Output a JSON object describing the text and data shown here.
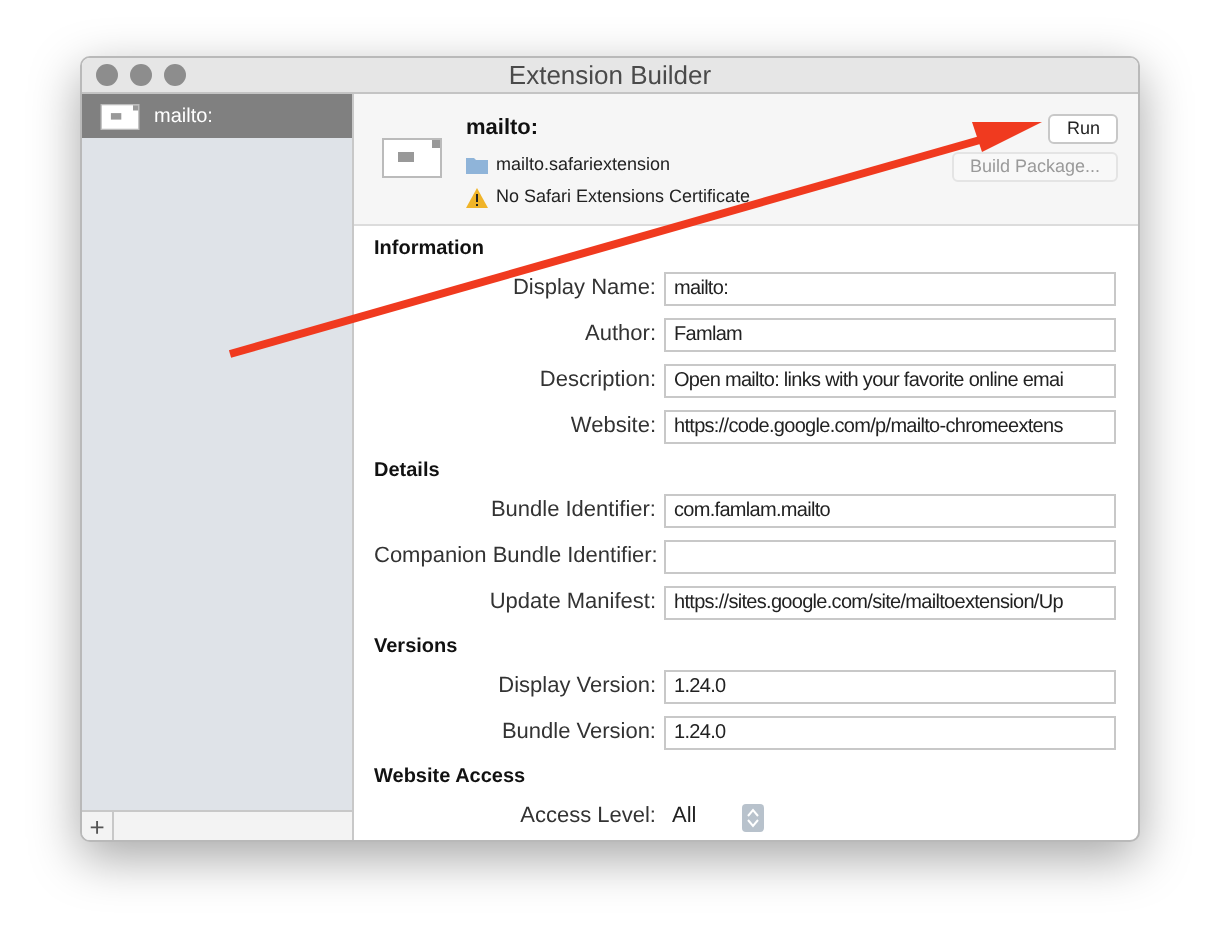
{
  "window": {
    "title": "Extension Builder"
  },
  "sidebar": {
    "items": [
      {
        "label": "mailto:",
        "selected": true
      }
    ],
    "add_button": "+"
  },
  "header": {
    "name": "mailto:",
    "file": "mailto.safariextension",
    "warning": "No Safari Extensions Certificate",
    "buttons": [
      {
        "label": "Run",
        "disabled": false
      },
      {
        "label": "Build Package...",
        "disabled": true
      }
    ]
  },
  "sections": [
    {
      "title": "Information",
      "fields": [
        {
          "label": "Display Name:",
          "value": "mailto:"
        },
        {
          "label": "Author:",
          "value": "Famlam"
        },
        {
          "label": "Description:",
          "value": "Open mailto: links with your favorite online emai"
        },
        {
          "label": "Website:",
          "value": "https://code.google.com/p/mailto-chromeextens"
        }
      ]
    },
    {
      "title": "Details",
      "fields": [
        {
          "label": "Bundle Identifier:",
          "value": "com.famlam.mailto"
        },
        {
          "label": "Companion Bundle Identifier:"
        },
        {
          "label": "Update Manifest:",
          "value": "https://sites.google.com/site/mailtoextension/Up"
        }
      ]
    },
    {
      "title": "Versions",
      "fields": [
        {
          "label": "Display Version:",
          "value": "1.24.0"
        },
        {
          "label": "Bundle Version:",
          "value": "1.24.0"
        }
      ]
    },
    {
      "title": "Website Access",
      "fields": [
        {
          "label": "Access Level:",
          "value": "All",
          "kind": "popup"
        }
      ]
    }
  ],
  "annotation": {
    "kind": "arrow"
  }
}
